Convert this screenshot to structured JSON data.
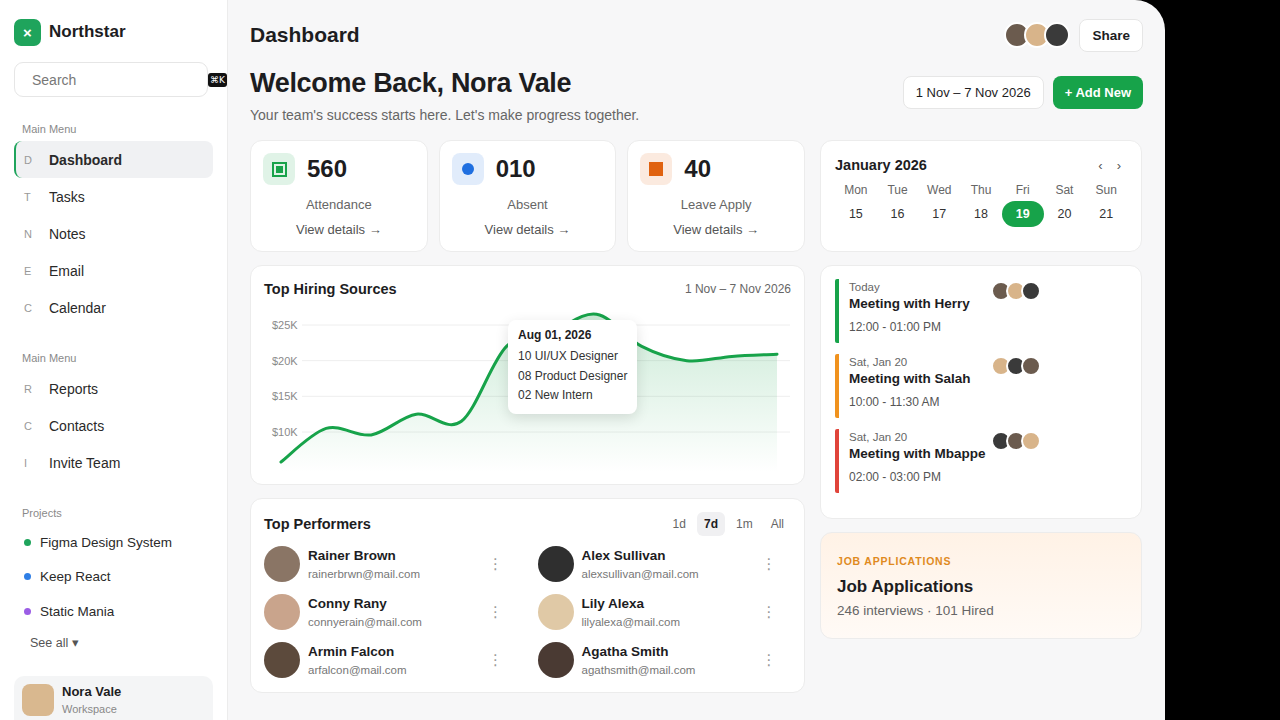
{
  "sidebar": {
    "logo": {
      "icon": "×",
      "name": "Northstar"
    },
    "search": {
      "placeholder": "Search",
      "shortcut": "⌘K"
    },
    "sections": [
      {
        "title": "Main Menu",
        "items": [
          {
            "icon": "D",
            "label": "Dashboard",
            "selected": true
          },
          {
            "icon": "T",
            "label": "Tasks",
            "selected": false
          },
          {
            "icon": "N",
            "label": "Notes",
            "selected": false
          },
          {
            "icon": "E",
            "label": "Email",
            "selected": false
          },
          {
            "icon": "C",
            "label": "Calendar",
            "selected": false
          }
        ]
      },
      {
        "title": "Main Menu",
        "items": [
          {
            "icon": "R",
            "label": "Reports",
            "selected": false
          },
          {
            "icon": "C",
            "label": "Contacts",
            "selected": false
          },
          {
            "icon": "I",
            "label": "Invite Team",
            "selected": false
          }
        ]
      }
    ],
    "projects": {
      "title": "Projects",
      "items": [
        {
          "label": "Figma Design System",
          "color": "#1fa45c"
        },
        {
          "label": "Keep React",
          "color": "#2f7fe6"
        },
        {
          "label": "Static Mania",
          "color": "#9b5de5"
        }
      ],
      "see_all": "See all ▾"
    },
    "user": {
      "name": "Nora Vale",
      "role": "Workspace"
    }
  },
  "header": {
    "title": "Dashboard",
    "share": "Share"
  },
  "welcome": {
    "title": "Welcome Back, Nora Vale",
    "subtitle": "Your team's success starts here. Let's make progress together.",
    "date_range": "1 Nov – 7 Nov 2026",
    "add_button": "+ Add New"
  },
  "stats": [
    {
      "value": "560",
      "label": "Attendance",
      "link": "View details →",
      "kind": "framed",
      "color": "#17a34a"
    },
    {
      "value": "010",
      "label": "Absent",
      "link": "View details →",
      "kind": "dot",
      "color": "#1f6fe0"
    },
    {
      "value": "40",
      "label": "Leave Apply",
      "link": "View details →",
      "kind": "solid",
      "color": "#e0620f"
    }
  ],
  "chart": {
    "title": "Top Hiring Sources",
    "range": "1 Nov – 7 Nov 2026",
    "y_ticks": [
      {
        "label": "$25K",
        "value": 25000
      },
      {
        "label": "$20K",
        "value": 20000
      },
      {
        "label": "$15K",
        "value": 15000
      },
      {
        "label": "$10K",
        "value": 10000
      }
    ],
    "series": [
      {
        "name": "Hires",
        "color": "#17a34a",
        "values": [
          5800,
          10500,
          9600,
          12500,
          11500,
          22000,
          24000,
          26500,
          22000,
          20000,
          20600,
          20900
        ]
      }
    ],
    "tooltip": {
      "title": "Aug 01, 2026",
      "lines": [
        "10 UI/UX Designer",
        "08 Product Designer",
        "02 New Intern"
      ]
    }
  },
  "performers": {
    "title": "Top Performers",
    "ranges": [
      {
        "label": "1d",
        "selected": false
      },
      {
        "label": "7d",
        "selected": true
      },
      {
        "label": "1m",
        "selected": false
      },
      {
        "label": "All",
        "selected": false
      }
    ],
    "menu_icon": "⋮",
    "people": [
      {
        "name": "Rainer Brown",
        "email": "rainerbrwn@mail.com"
      },
      {
        "name": "Conny Rany",
        "email": "connyerain@mail.com"
      },
      {
        "name": "Armin Falcon",
        "email": "arfalcon@mail.com"
      },
      {
        "name": "Alex Sullivan",
        "email": "alexsullivan@mail.com"
      },
      {
        "name": "Lily Alexa",
        "email": "lilyalexa@mail.com"
      },
      {
        "name": "Agatha Smith",
        "email": "agathsmith@mail.com"
      }
    ]
  },
  "calendar": {
    "month": "January 2026",
    "prev": "‹",
    "next": "›",
    "weekdays": [
      "Mon",
      "Tue",
      "Wed",
      "Thu",
      "Fri",
      "Sat",
      "Sun"
    ],
    "days": [
      {
        "label": "15",
        "selected": false
      },
      {
        "label": "16",
        "selected": false
      },
      {
        "label": "17",
        "selected": false
      },
      {
        "label": "18",
        "selected": false
      },
      {
        "label": "19",
        "selected": true
      },
      {
        "label": "20",
        "selected": false
      },
      {
        "label": "21",
        "selected": false
      }
    ]
  },
  "events": [
    {
      "date": "Today",
      "title": "Meeting with Herry",
      "time": "12:00 - 01:00 PM",
      "color": "#17a34a"
    },
    {
      "date": "Sat, Jan 20",
      "title": "Meeting with Salah",
      "time": "10:00 - 11:30 AM",
      "color": "#f0921e"
    },
    {
      "date": "Sat, Jan 20",
      "title": "Meeting with Mbappe",
      "time": "02:00 - 03:00 PM",
      "color": "#e0443a"
    }
  ],
  "jobs": {
    "label": "JOB APPLICATIONS",
    "title": "Job Applications",
    "summary": "246 interviews · 101 Hired"
  }
}
